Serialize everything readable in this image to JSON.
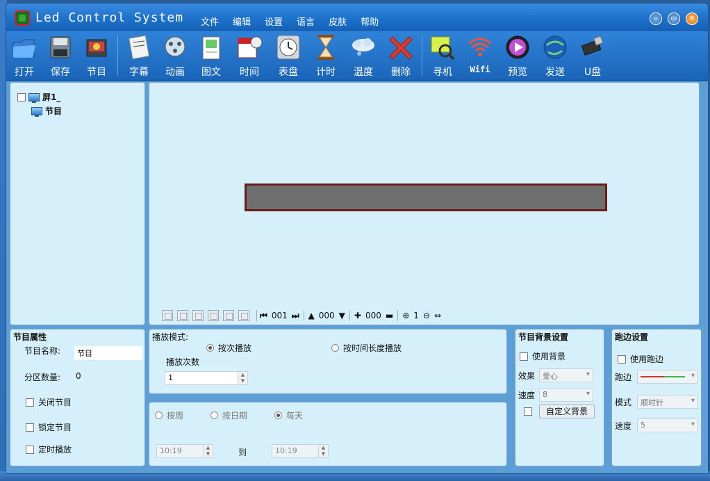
{
  "window": {
    "title": "Led Control System",
    "menu": [
      "文件",
      "编辑",
      "设置",
      "语言",
      "皮肤",
      "帮助"
    ]
  },
  "toolbar": {
    "items": [
      {
        "label": "打开",
        "icon": "folder-open-icon"
      },
      {
        "label": "保存",
        "icon": "save-icon"
      },
      {
        "label": "节目",
        "icon": "program-icon"
      },
      {
        "label": "字幕",
        "icon": "subtitle-icon"
      },
      {
        "label": "动画",
        "icon": "animation-icon"
      },
      {
        "label": "图文",
        "icon": "picture-text-icon"
      },
      {
        "label": "时间",
        "icon": "calendar-clock-icon"
      },
      {
        "label": "表盘",
        "icon": "clock-dial-icon"
      },
      {
        "label": "计时",
        "icon": "hourglass-icon"
      },
      {
        "label": "温度",
        "icon": "temperature-icon"
      },
      {
        "label": "删除",
        "icon": "delete-icon"
      },
      {
        "label": "寻机",
        "icon": "search-device-icon"
      },
      {
        "label": "Wifi",
        "icon": "wifi-icon"
      },
      {
        "label": "预览",
        "icon": "preview-play-icon"
      },
      {
        "label": "发送",
        "icon": "send-globe-icon"
      },
      {
        "label": "U盘",
        "icon": "usb-icon"
      }
    ]
  },
  "tree": {
    "screen": "屏1_",
    "program": "节目"
  },
  "preview_toolbar": {
    "page": "001",
    "up_value": "000",
    "plus_value": "000",
    "zoom": "1"
  },
  "program_props": {
    "title": "节目属性",
    "name_label": "节目名称:",
    "name_value": "节目",
    "area_count_label": "分区数量:",
    "area_count_value": "0",
    "close_program": "关闭节目",
    "lock_program": "锁定节目",
    "timed_play": "定时播放"
  },
  "play_mode": {
    "title": "播放模式:",
    "by_count": "按次播放",
    "by_duration": "按时间长度播放",
    "count_label": "播放次数",
    "count_value": "1"
  },
  "schedule": {
    "by_week": "按周",
    "by_date": "按日期",
    "daily": "每天",
    "start_time": "10:19",
    "to_label": "到",
    "end_time": "10:19"
  },
  "background": {
    "title": "节目背景设置",
    "use_bg": "使用背景",
    "effect_label": "效果",
    "effect_value": "爱心",
    "speed_label": "速度",
    "speed_value": "8",
    "custom_button": "自定义背景"
  },
  "border": {
    "title": "跑边设置",
    "use_border": "使用跑边",
    "border_label": "跑边",
    "mode_label": "模式",
    "mode_value": "顺时针",
    "speed_label": "速度",
    "speed_value": "5"
  }
}
